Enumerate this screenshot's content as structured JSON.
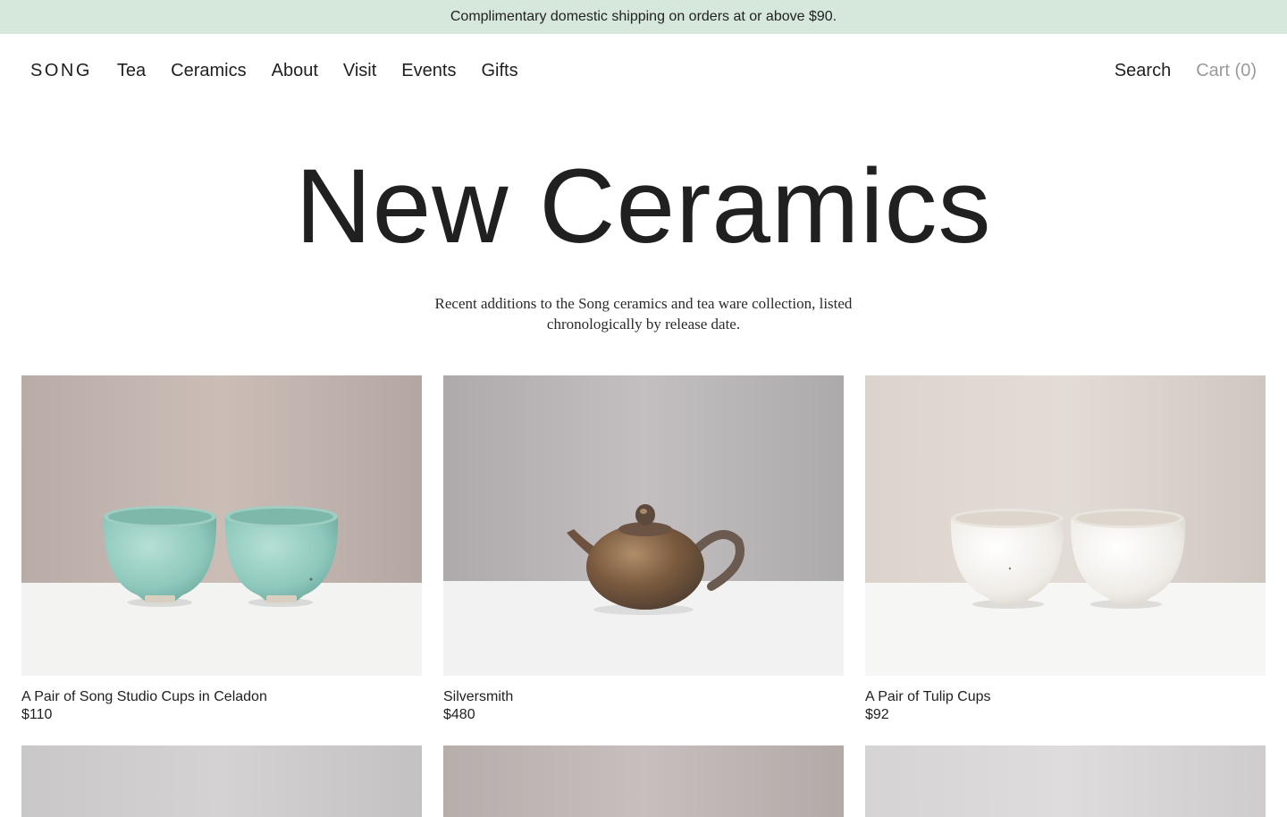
{
  "announcement": {
    "text": "Complimentary domestic shipping on orders at or above $90."
  },
  "header": {
    "logo": "SONG",
    "nav": [
      "Tea",
      "Ceramics",
      "About",
      "Visit",
      "Events",
      "Gifts"
    ],
    "search_label": "Search",
    "cart_label": "Cart (0)"
  },
  "hero": {
    "title": "New Ceramics",
    "description": "Recent additions to the Song ceramics and tea ware collection, listed chronologically by release date."
  },
  "products": [
    {
      "title": "A Pair of Song Studio Cups in Celadon",
      "price": "$110",
      "image": "celadon-cups-photo"
    },
    {
      "title": "Silversmith",
      "price": "$480",
      "image": "teapot-photo"
    },
    {
      "title": "A Pair of Tulip Cups",
      "price": "$92",
      "image": "white-cups-photo"
    }
  ],
  "colors": {
    "announcement_bg": "#d6e8dc",
    "text": "#1f1f1f",
    "cart_muted": "#9a9a9a"
  }
}
